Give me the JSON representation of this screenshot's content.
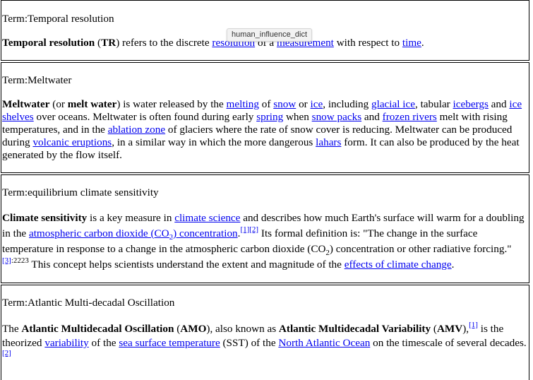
{
  "tooltip": "human_influence_dict",
  "cards": [
    {
      "term": "Term:Temporal resolution",
      "def": [
        {
          "t": "b",
          "v": "Temporal resolution"
        },
        {
          "t": "t",
          "v": " ("
        },
        {
          "t": "b",
          "v": "TR"
        },
        {
          "t": "t",
          "v": ") refers to the discrete "
        },
        {
          "t": "a",
          "v": "resolution"
        },
        {
          "t": "t",
          "v": " of a "
        },
        {
          "t": "a",
          "v": "measurement"
        },
        {
          "t": "t",
          "v": " with respect to "
        },
        {
          "t": "a",
          "v": "time"
        },
        {
          "t": "t",
          "v": "."
        }
      ]
    },
    {
      "term": "Term:Meltwater",
      "def": [
        {
          "t": "b",
          "v": "Meltwater"
        },
        {
          "t": "t",
          "v": " (or "
        },
        {
          "t": "b",
          "v": "melt water"
        },
        {
          "t": "t",
          "v": ") is water released by the "
        },
        {
          "t": "a",
          "v": "melting"
        },
        {
          "t": "t",
          "v": " of "
        },
        {
          "t": "a",
          "v": "snow"
        },
        {
          "t": "t",
          "v": " or "
        },
        {
          "t": "a",
          "v": "ice"
        },
        {
          "t": "t",
          "v": ", including "
        },
        {
          "t": "a",
          "v": "glacial ice"
        },
        {
          "t": "t",
          "v": ", tabular "
        },
        {
          "t": "a",
          "v": "icebergs"
        },
        {
          "t": "t",
          "v": " and "
        },
        {
          "t": "a",
          "v": "ice shelves"
        },
        {
          "t": "t",
          "v": " over oceans. Meltwater is often found during early "
        },
        {
          "t": "a",
          "v": "spring"
        },
        {
          "t": "t",
          "v": " when "
        },
        {
          "t": "a",
          "v": "snow packs"
        },
        {
          "t": "t",
          "v": " and "
        },
        {
          "t": "a",
          "v": "frozen rivers"
        },
        {
          "t": "t",
          "v": " melt with rising temperatures, and in the "
        },
        {
          "t": "a",
          "v": "ablation zone"
        },
        {
          "t": "t",
          "v": " of glaciers where the rate of snow cover is reducing. Meltwater can be produced during "
        },
        {
          "t": "a",
          "v": "volcanic eruptions"
        },
        {
          "t": "t",
          "v": ", in a similar way in which the more dangerous "
        },
        {
          "t": "a",
          "v": "lahars"
        },
        {
          "t": "t",
          "v": " form. It can also be produced by the heat generated by the flow itself."
        }
      ]
    },
    {
      "term": "Term:equilibrium climate sensitivity",
      "def": [
        {
          "t": "b",
          "v": "Climate sensitivity"
        },
        {
          "t": "t",
          "v": " is a key measure in "
        },
        {
          "t": "a",
          "v": "climate science"
        },
        {
          "t": "t",
          "v": " and describes how much Earth's surface will warm for a doubling in the "
        },
        {
          "t": "a",
          "v": "atmospheric carbon dioxide (CO"
        },
        {
          "t": "asub",
          "v": "2"
        },
        {
          "t": "a",
          "v": ") concentration"
        },
        {
          "t": "t",
          "v": "."
        },
        {
          "t": "supa",
          "v": "[1]"
        },
        {
          "t": "supa",
          "v": "[2]"
        },
        {
          "t": "t",
          "v": " Its formal definition is: \"The change in the surface temperature in response to a change in the atmospheric carbon dioxide (CO"
        },
        {
          "t": "sub",
          "v": "2"
        },
        {
          "t": "t",
          "v": ") concentration or other radiative forcing.\""
        },
        {
          "t": "supa",
          "v": "[3]"
        },
        {
          "t": "sup",
          "v": ":2223"
        },
        {
          "t": "t",
          "v": " This concept helps scientists understand the extent and magnitude of the "
        },
        {
          "t": "a",
          "v": "effects of climate change"
        },
        {
          "t": "t",
          "v": "."
        }
      ]
    },
    {
      "term": "Term:Atlantic Multi-decadal Oscillation",
      "def": [
        {
          "t": "t",
          "v": "The "
        },
        {
          "t": "b",
          "v": "Atlantic Multidecadal Oscillation"
        },
        {
          "t": "t",
          "v": " ("
        },
        {
          "t": "b",
          "v": "AMO"
        },
        {
          "t": "t",
          "v": "), also known as "
        },
        {
          "t": "b",
          "v": "Atlantic Multidecadal Variability"
        },
        {
          "t": "t",
          "v": " ("
        },
        {
          "t": "b",
          "v": "AMV"
        },
        {
          "t": "t",
          "v": "),"
        },
        {
          "t": "supa",
          "v": "[1]"
        },
        {
          "t": "t",
          "v": " is the theorized "
        },
        {
          "t": "a",
          "v": "variability"
        },
        {
          "t": "t",
          "v": " of the "
        },
        {
          "t": "a",
          "v": "sea surface temperature"
        },
        {
          "t": "t",
          "v": " (SST) of the "
        },
        {
          "t": "a",
          "v": "North Atlantic Ocean"
        },
        {
          "t": "t",
          "v": " on the timescale of several decades."
        },
        {
          "t": "supa",
          "v": "[2]"
        }
      ]
    }
  ]
}
